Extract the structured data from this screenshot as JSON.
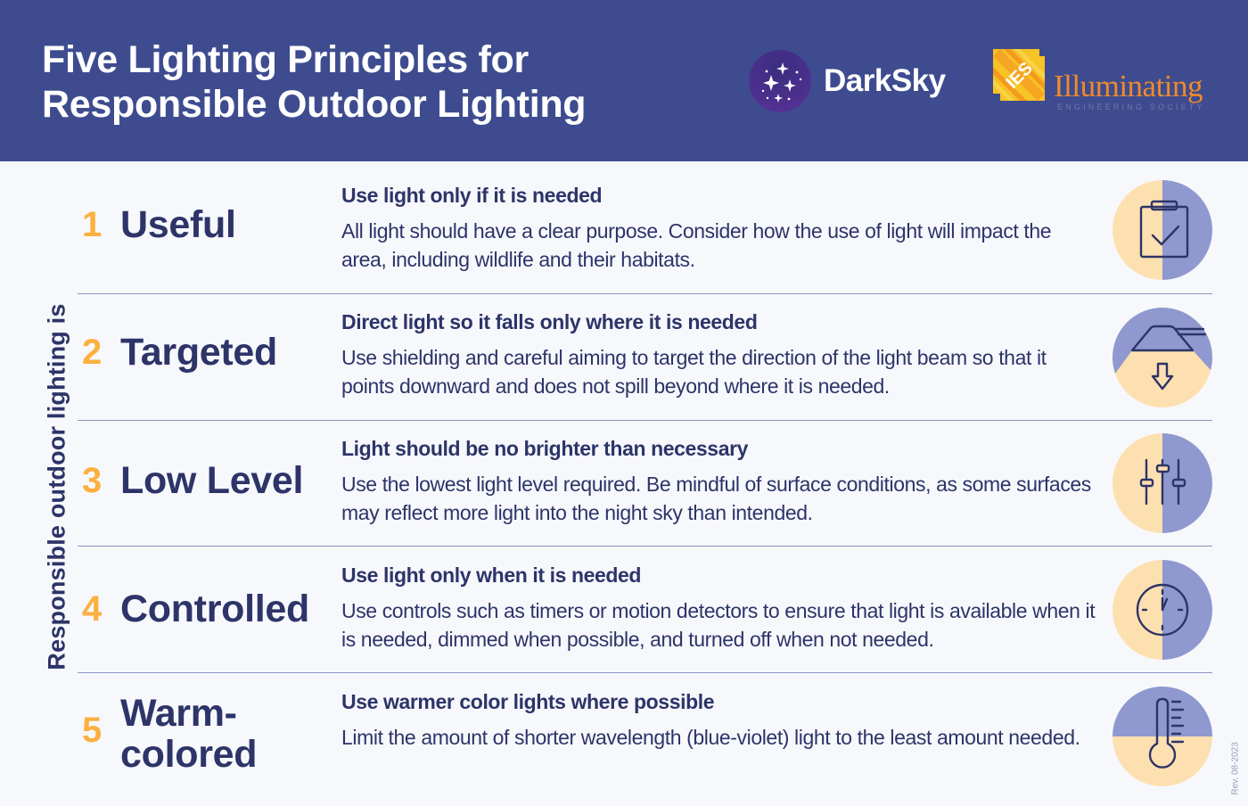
{
  "header": {
    "title_line1": "Five Lighting Principles for",
    "title_line2": "Responsible Outdoor Lighting",
    "logos": {
      "darksky": {
        "name": "DarkSky",
        "icon": "starry-sky-icon"
      },
      "ies": {
        "mark": "IES",
        "name": "Illuminating",
        "subtitle": "ENGINEERING SOCIETY"
      }
    },
    "colors": {
      "background": "#3e4c8f",
      "ies_orange": "#f08a2a"
    }
  },
  "side_label": "Responsible outdoor lighting is",
  "colors": {
    "number": "#fbb03f",
    "text": "#2d3468",
    "icon_warm": "#fde0b0",
    "icon_cool": "#8f99cf"
  },
  "principles": [
    {
      "number": "1",
      "name": "Useful",
      "subhead": "Use light only if it is needed",
      "description": "All light should have a clear purpose. Consider how the use of light will impact the area, including wildlife and their habitats.",
      "icon": "clipboard-check-icon"
    },
    {
      "number": "2",
      "name": "Targeted",
      "subhead": "Direct light so it falls only where it is needed",
      "description": "Use shielding and careful aiming to target the direction of the light beam so that it points downward and does not spill beyond where it is needed.",
      "icon": "shielded-lamp-down-arrow-icon"
    },
    {
      "number": "3",
      "name": "Low Level",
      "subhead": "Light should be no brighter than necessary",
      "description": "Use the lowest light level required. Be mindful of surface conditions, as some surfaces may reflect more light into the night sky than intended.",
      "icon": "sliders-icon"
    },
    {
      "number": "4",
      "name": "Controlled",
      "subhead": "Use light only when it is needed",
      "description": "Use controls such as timers or motion detectors to ensure that light is available when it is needed, dimmed when possible, and turned off when not needed.",
      "icon": "clock-icon"
    },
    {
      "number": "5",
      "name_line1": "Warm-",
      "name_line2": "colored",
      "subhead": "Use warmer color lights where possible",
      "description": "Limit the amount of shorter wavelength (blue-violet) light to the least amount needed.",
      "icon": "thermometer-icon"
    }
  ],
  "revision": "Rev. 08-2023"
}
